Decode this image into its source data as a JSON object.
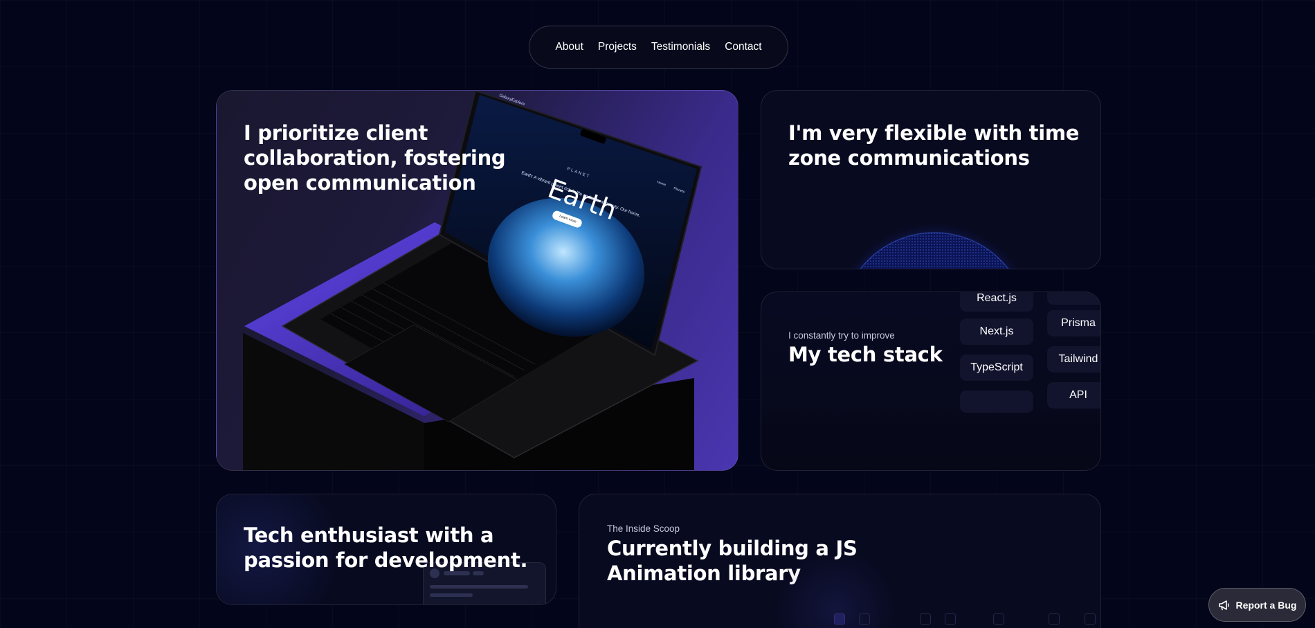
{
  "nav": {
    "items": [
      "About",
      "Projects",
      "Testimonials",
      "Contact"
    ]
  },
  "cards": {
    "collab": {
      "title_line1": "I prioritize client",
      "title_line2": "collaboration, fostering",
      "title_line3": "open communication",
      "laptop_screen": {
        "label": "PLANET",
        "heading": "Earth",
        "tagline": "Earth: A vibrant planet rich in life and natural beauty. Our home.",
        "cta": "Learn more",
        "nav_home": "Home",
        "nav_planets": "Planets",
        "brand": "GalaxyExplore"
      }
    },
    "timezone": {
      "title_line1": "I'm very flexible with time",
      "title_line2": "zone communications"
    },
    "stack": {
      "eyebrow": "I constantly try to improve",
      "title": "My tech stack",
      "col1": [
        "React.js",
        "Next.js",
        "TypeScript",
        ""
      ],
      "col2": [
        "",
        "Prisma",
        "Tailwind",
        "API"
      ]
    },
    "enthusiast": {
      "title_line1": "Tech enthusiast with a",
      "title_line2": "passion for development."
    },
    "scoop": {
      "eyebrow": "The Inside Scoop",
      "title_line1": "Currently building a JS",
      "title_line2": "Animation library"
    }
  },
  "report_bug": {
    "label": "Report a Bug",
    "icon": "megaphone-icon"
  },
  "colors": {
    "background": "#03051a",
    "accent_purple": "#4a36b0"
  }
}
